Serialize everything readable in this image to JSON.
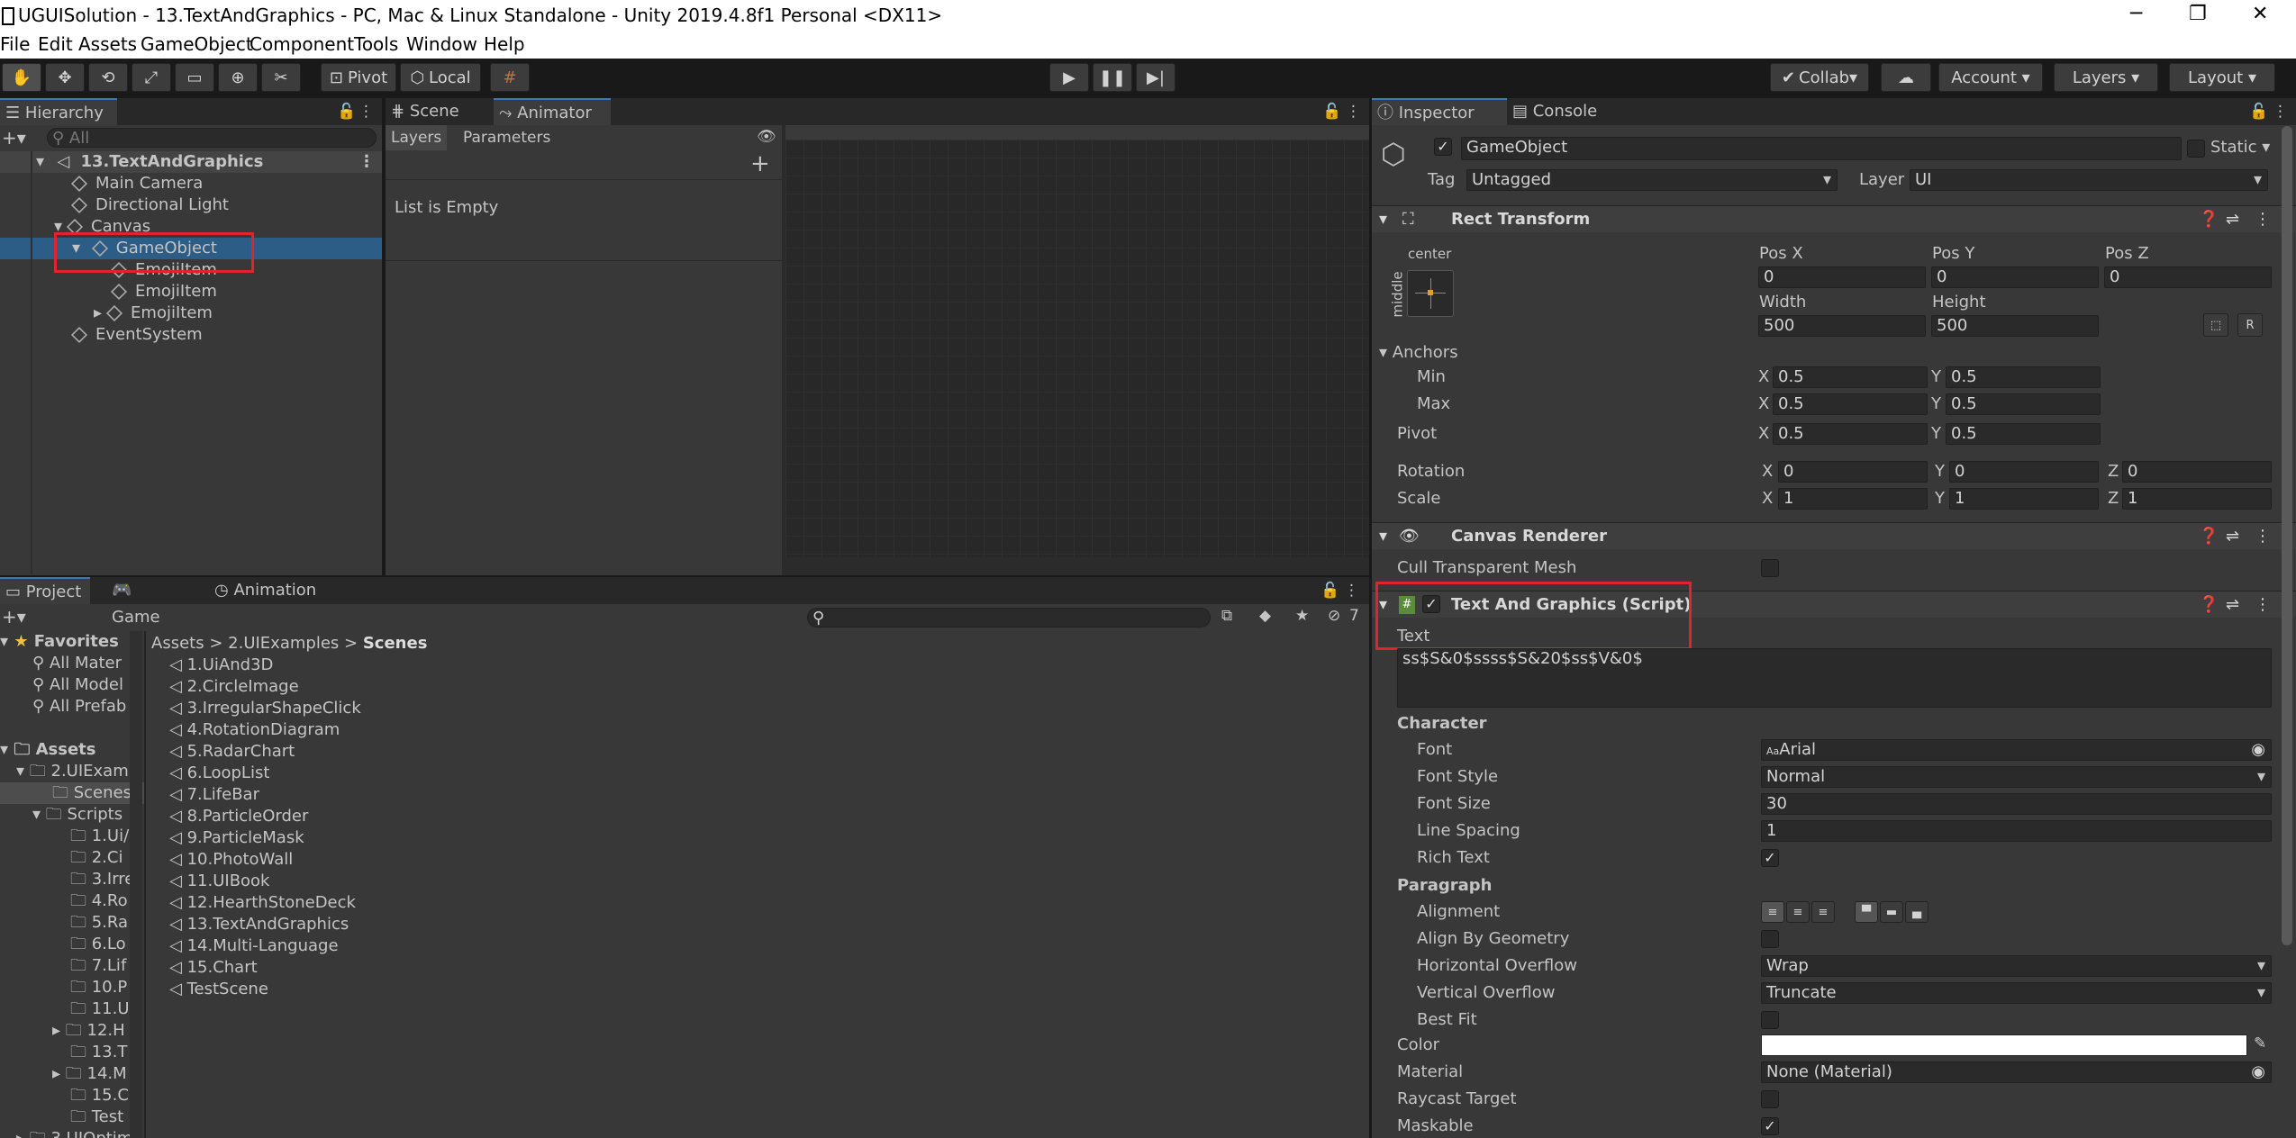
{
  "window": {
    "title": "UGUISolution - 13.TextAndGraphics - PC, Mac & Linux Standalone - Unity 2019.4.8f1 Personal <DX11>"
  },
  "menu": [
    "File",
    "Edit",
    "Assets",
    "GameObject",
    "Component",
    "Tools",
    "Window",
    "Help"
  ],
  "toolbar": {
    "pivot": "Pivot",
    "local": "Local",
    "collab": "Collab",
    "account": "Account",
    "layers": "Layers",
    "layout": "Layout"
  },
  "hierarchy": {
    "tab": "Hierarchy",
    "search_placeholder": "All",
    "scene": "13.TextAndGraphics",
    "items": [
      "Main Camera",
      "Directional Light",
      "Canvas",
      "GameObject",
      "EmojiItem",
      "EmojiItem",
      "EmojiItem",
      "EventSystem"
    ]
  },
  "scene_tabs": {
    "scene": "Scene",
    "animator": "Animator"
  },
  "animator": {
    "layers": "Layers",
    "parameters": "Parameters",
    "empty": "List is Empty"
  },
  "project": {
    "tabs": [
      "Project",
      "Game",
      "Animation"
    ],
    "favorites": "Favorites",
    "fav_items": [
      "All Mater",
      "All Model",
      "All Prefab"
    ],
    "assets": "Assets",
    "tree": [
      "2.UIExam",
      "Scenes",
      "Scripts",
      "1.Ui/",
      "2.Ci",
      "3.Irre",
      "4.Ro",
      "5.Ra",
      "6.Lo",
      "7.Lif",
      "10.P",
      "11.U",
      "12.H",
      "13.T",
      "14.M",
      "15.C",
      "Test",
      "3.UIOptim"
    ],
    "breadcrumb": [
      "Assets",
      "2.UIExamples",
      "Scenes"
    ],
    "badge": "7",
    "scenes": [
      "1.UiAnd3D",
      "2.CircleImage",
      "3.IrregularShapeClick",
      "4.RotationDiagram",
      "5.RadarChart",
      "6.LoopList",
      "7.LifeBar",
      "8.ParticleOrder",
      "9.ParticleMask",
      "10.PhotoWall",
      "11.UIBook",
      "12.HearthStoneDeck",
      "13.TextAndGraphics",
      "14.Multi-Language",
      "15.Chart",
      "TestScene"
    ]
  },
  "inspector": {
    "tabs": [
      "Inspector",
      "Console"
    ],
    "name": "GameObject",
    "static": "Static",
    "tag_label": "Tag",
    "tag": "Untagged",
    "layer_label": "Layer",
    "layer": "UI",
    "rect": {
      "title": "Rect Transform",
      "anchor_h": "center",
      "anchor_v": "middle",
      "posx_l": "Pos X",
      "posy_l": "Pos Y",
      "posz_l": "Pos Z",
      "posx": "0",
      "posy": "0",
      "posz": "0",
      "width_l": "Width",
      "height_l": "Height",
      "width": "500",
      "height": "500",
      "anchors": "Anchors",
      "min": "Min",
      "max": "Max",
      "pivot": "Pivot",
      "min_x": "0.5",
      "min_y": "0.5",
      "max_x": "0.5",
      "max_y": "0.5",
      "pivot_x": "0.5",
      "pivot_y": "0.5",
      "rotation": "Rotation",
      "scale": "Scale",
      "rot_x": "0",
      "rot_y": "0",
      "rot_z": "0",
      "scale_x": "1",
      "scale_y": "1",
      "scale_z": "1",
      "x": "X",
      "y": "Y",
      "z": "Z",
      "r": "R"
    },
    "canvas_renderer": {
      "title": "Canvas Renderer",
      "cull": "Cull Transparent Mesh"
    },
    "script": {
      "title": "Text And Graphics (Script)",
      "text_label": "Text",
      "text_value": "ss$S&0$ssss$S&20$ss$V&0$",
      "character": "Character",
      "font_l": "Font",
      "font_icon": "Aa",
      "font": "Arial",
      "font_style_l": "Font Style",
      "font_style": "Normal",
      "font_size_l": "Font Size",
      "font_size": "30",
      "line_spacing_l": "Line Spacing",
      "line_spacing": "1",
      "rich_text_l": "Rich Text",
      "paragraph": "Paragraph",
      "alignment_l": "Alignment",
      "align_geom_l": "Align By Geometry",
      "h_overflow_l": "Horizontal Overflow",
      "h_overflow": "Wrap",
      "v_overflow_l": "Vertical Overflow",
      "v_overflow": "Truncate",
      "best_fit_l": "Best Fit",
      "color_l": "Color",
      "material_l": "Material",
      "material": "None (Material)",
      "raycast_l": "Raycast Target",
      "maskable_l": "Maskable"
    },
    "check": "✓"
  },
  "colors": {
    "selection": "#2c5d87",
    "highlight": "#e0242f",
    "accent": "#3a79bb"
  }
}
